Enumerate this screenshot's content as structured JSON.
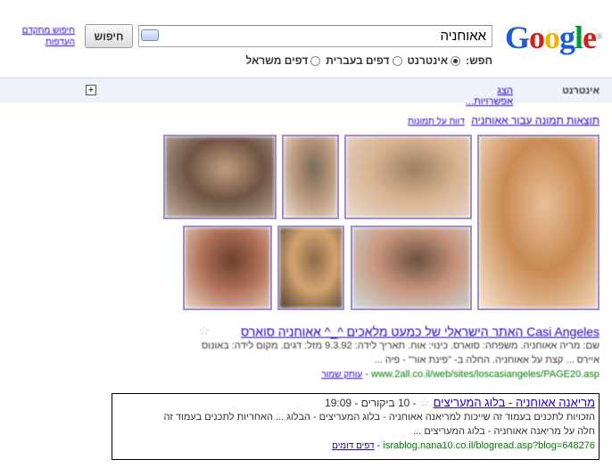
{
  "logo": {
    "text": "Google",
    "colors": [
      "#1a5bd6",
      "#d2231b",
      "#f0b400",
      "#1a5bd6",
      "#009933",
      "#d2231b"
    ]
  },
  "search": {
    "query": "אאוחניה",
    "button_label": "חיפוש",
    "advanced": "חיפוש מתקדם העדפות"
  },
  "search_options": {
    "prefix": "חפש:",
    "items": [
      {
        "label": "אינטרנט",
        "selected": true
      },
      {
        "label": "דפים בעברית",
        "selected": false
      },
      {
        "label": "דפים משראל",
        "selected": false
      }
    ]
  },
  "results_bar": {
    "label": "אינטרנט",
    "options_link": "הצג אפשרויות..."
  },
  "images": {
    "heading_link": "תוצאות תמונה עבור אאוחניה",
    "sub_link": "דווח על תמונות",
    "thumbs": [
      {
        "colors": [
          "#e7c09a",
          "#c98a52",
          "#f7e6d0"
        ]
      },
      {
        "colors": [
          "#9d7f62",
          "#d8b390",
          "#e8dad0"
        ]
      },
      {
        "colors": [
          "#7a6a58",
          "#b8967b",
          "#ece0d2"
        ]
      },
      {
        "colors": [
          "#c49d7e",
          "#6e5443",
          "#c5b2a2"
        ]
      },
      {
        "colors": [
          "#6a3f2b",
          "#b07058",
          "#eed5c7"
        ]
      },
      {
        "colors": [
          "#8d6948",
          "#d5a571",
          "#4c3a30"
        ]
      },
      {
        "colors": [
          "#6a5040",
          "#c9967d",
          "#cfdde0"
        ]
      },
      {
        "colors": [
          "#d8b2a2",
          "#c23b3f",
          "#e8d4c8"
        ]
      }
    ]
  },
  "result1": {
    "title": "Casi Angeles האתר הישראלי של כמעט מלאכים ^_^ אאוחניה סוארס",
    "line1": "שם: מריה אאוחניה. משפחה: סוארס. כינוי: אוח. תאריך לידה: 9.3.92 מזל: דגים. מקום לידה: באונוס",
    "line2": "איירס ... קצת על אאוחניה. החלה ב- \"פינת אור\" - פיה ...",
    "url": "www.2all.co.il/web/sites/loscasiangeles/PAGE20.asp",
    "cache": "עותק שמור"
  },
  "result2": {
    "title": "מריאנה אאוחניה - בלוג המעריצים",
    "meta": "- 10 ביקורים - 19:09",
    "line1": "הזכויות לתכנים בעמוד זה שייכות למריאנה אאוחניה - בלוג המעריצים - הבלוג ... האחריות לתכנים בעמוד זה",
    "line2": "חלה על מריאנה אאוחניה - בלוג המעריצים ...",
    "url": "israblog.nana10.co.il/blogread.asp?blog=648276",
    "similar": "דפים דומים"
  }
}
